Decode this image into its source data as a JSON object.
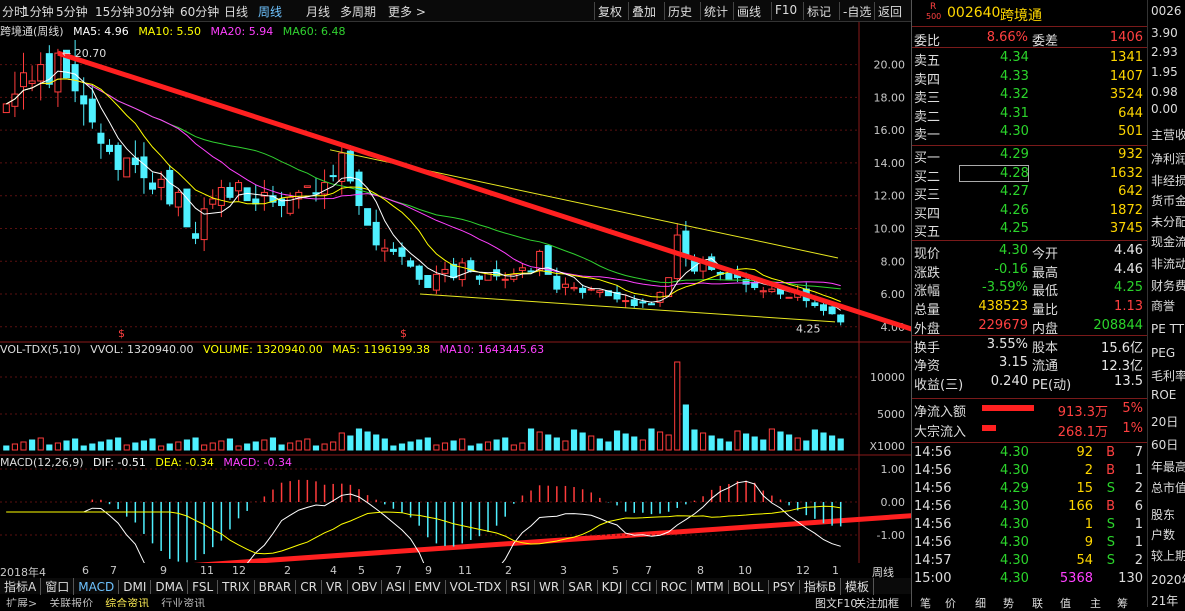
{
  "top_tabs": [
    "分时",
    "1分钟",
    "5分钟",
    "15分钟",
    "30分钟",
    "60分钟",
    "日线",
    "周线",
    "月线",
    "多周期",
    "更多 >"
  ],
  "top_tools": [
    "复权",
    "叠加",
    "历史",
    "统计",
    "画线",
    "F10",
    "标记",
    "-自选",
    "返回"
  ],
  "chart_title": "跨境通(周线)",
  "main_legend": {
    "ma5": "MA5: 4.96",
    "ma10": "MA10: 5.50",
    "ma20": "MA20: 5.94",
    "ma60": "MA60: 6.48"
  },
  "vol_legend": {
    "name": "VOL-TDX(5,10)",
    "vvol": "VVOL: 1320940.00",
    "volume": "VOLUME: 1320940.00",
    "ma5": "MA5: 1196199.38",
    "ma10": "MA10: 1643445.63"
  },
  "macd_legend": {
    "name": "MACD(12,26,9)",
    "dif": "DIF: -0.51",
    "dea": "DEA: -0.34",
    "macd": "MACD: -0.34"
  },
  "price_axis": [
    "20.00",
    "18.00",
    "16.00",
    "14.00",
    "12.00",
    "10.00",
    "8.00",
    "6.00",
    "4.00"
  ],
  "vol_axis": [
    "10000",
    "5000",
    "X1000"
  ],
  "macd_axis": [
    "1.00",
    "0.00",
    "-1.00"
  ],
  "high_label": "20.70",
  "low_label": "4.25",
  "dollar_mark": "$",
  "x_axis": [
    "2018年4",
    "6",
    "7",
    "9",
    "11",
    "12",
    "2",
    "4",
    "5",
    "7",
    "9",
    "11",
    "2",
    "3",
    "5",
    "7",
    "8",
    "10",
    "12",
    "1"
  ],
  "period_label": "周线",
  "indicator_tabs": [
    "指标A",
    "窗口",
    "MACD",
    "DMI",
    "DMA",
    "FSL",
    "TRIX",
    "BRAR",
    "CR",
    "VR",
    "OBV",
    "ASI",
    "EMV",
    "VOL-TDX",
    "RSI",
    "WR",
    "SAR",
    "KDJ",
    "CCI",
    "ROC",
    "MTM",
    "BOLL",
    "PSY",
    "指标B",
    "模板"
  ],
  "bottom_tabs": [
    "扩展>",
    "关联报价",
    "综合资讯",
    "行业资讯"
  ],
  "bottom_right": [
    "图文F10",
    "关注加框",
    "笔",
    "价",
    "细",
    "势",
    "联",
    "值",
    "主",
    "筹"
  ],
  "chart_data": {
    "type": "candlestick",
    "title": "跨境通(周线)",
    "period": "weekly",
    "ylim": [
      3.5,
      21.5
    ],
    "weekly_close": [
      17.6,
      18.2,
      19.5,
      19.0,
      20.0,
      18.8,
      20.7,
      19.2,
      18.4,
      17.6,
      16.5,
      15.2,
      14.7,
      13.6,
      14.3,
      13.9,
      13.1,
      12.4,
      13.0,
      11.5,
      12.2,
      10.1,
      9.4,
      11.2,
      11.8,
      12.5,
      11.9,
      12.8,
      11.7,
      11.5,
      12.2,
      11.6,
      11.4,
      11.9,
      12.2,
      12.6,
      12.1,
      12.8,
      13.2,
      14.6,
      12.9,
      11.4,
      10.2,
      9.0,
      8.8,
      8.6,
      8.3,
      7.7,
      6.9,
      6.4,
      7.2,
      7.5,
      7.0,
      7.9,
      7.4,
      6.9,
      7.3,
      7.1,
      6.9,
      7.2,
      7.6,
      7.4,
      8.6,
      7.2,
      6.3,
      6.6,
      6.4,
      6.1,
      6.3,
      6.2,
      5.9,
      5.7,
      5.6,
      5.3,
      5.5,
      5.4,
      6.1,
      7.0,
      9.6,
      8.3,
      7.4,
      8.0,
      7.5,
      7.2,
      6.9,
      7.0,
      6.6,
      6.4,
      6.2,
      6.3,
      6.0,
      5.8,
      6.1,
      5.6,
      5.3,
      5.0,
      4.8,
      4.3
    ],
    "ma5": 4.96,
    "ma10": 5.5,
    "ma20": 5.94,
    "ma60": 6.48,
    "volume_scale": "X1000",
    "vol_ma5": 1196199.38,
    "vol_ma10": 1643445.63,
    "volume": 1320940.0,
    "macd": {
      "dif": -0.51,
      "dea": -0.34,
      "macd": -0.34
    }
  },
  "rp_header": {
    "badge": "R",
    "code": "002640",
    "name": "跨境通",
    "badge2": "500"
  },
  "weibi": {
    "l1": "委比",
    "v1": "8.66%",
    "l2": "委差",
    "v2": "1406"
  },
  "sell": [
    {
      "label": "卖五",
      "price": "4.34",
      "vol": "1341"
    },
    {
      "label": "卖四",
      "price": "4.33",
      "vol": "1407"
    },
    {
      "label": "卖三",
      "price": "4.32",
      "vol": "3524"
    },
    {
      "label": "卖二",
      "price": "4.31",
      "vol": "644"
    },
    {
      "label": "卖一",
      "price": "4.30",
      "vol": "501"
    }
  ],
  "buy": [
    {
      "label": "买一",
      "price": "4.29",
      "vol": "932"
    },
    {
      "label": "买二",
      "price": "4.28",
      "vol": "1632"
    },
    {
      "label": "买三",
      "price": "4.27",
      "vol": "642"
    },
    {
      "label": "买四",
      "price": "4.26",
      "vol": "1872"
    },
    {
      "label": "买五",
      "price": "4.25",
      "vol": "3745"
    }
  ],
  "stats": [
    {
      "l1": "现价",
      "v1": "4.30",
      "c1": "green",
      "l2": "今开",
      "v2": "4.46",
      "c2": "white"
    },
    {
      "l1": "涨跌",
      "v1": "-0.16",
      "c1": "green",
      "l2": "最高",
      "v2": "4.46",
      "c2": "white"
    },
    {
      "l1": "涨幅",
      "v1": "-3.59%",
      "c1": "green",
      "l2": "最低",
      "v2": "4.25",
      "c2": "green"
    },
    {
      "l1": "总量",
      "v1": "438523",
      "c1": "yellow",
      "l2": "量比",
      "v2": "1.13",
      "c2": "red"
    },
    {
      "l1": "外盘",
      "v1": "229679",
      "c1": "red",
      "l2": "内盘",
      "v2": "208844",
      "c2": "green"
    },
    {
      "l1": "换手",
      "v1": "3.55%",
      "c1": "white",
      "l2": "股本",
      "v2": "15.6亿",
      "c2": "white"
    },
    {
      "l1": "净资",
      "v1": "3.15",
      "c1": "white",
      "l2": "流通",
      "v2": "12.3亿",
      "c2": "white"
    },
    {
      "l1": "收益(三)",
      "v1": "0.240",
      "c1": "white",
      "l2": "PE(动)",
      "v2": "13.5",
      "c2": "white"
    }
  ],
  "flows": [
    {
      "label": "净流入额",
      "value": "913.3万",
      "pct": "5%"
    },
    {
      "label": "大宗流入",
      "value": "268.1万",
      "pct": "1%"
    }
  ],
  "ticks": [
    {
      "t": "14:56",
      "p": "4.30",
      "v": "92",
      "s": "B",
      "n": "7"
    },
    {
      "t": "14:56",
      "p": "4.30",
      "v": "2",
      "s": "B",
      "n": "1"
    },
    {
      "t": "14:56",
      "p": "4.29",
      "v": "15",
      "s": "S",
      "n": "2"
    },
    {
      "t": "14:56",
      "p": "4.30",
      "v": "166",
      "s": "B",
      "n": "6"
    },
    {
      "t": "14:56",
      "p": "4.30",
      "v": "1",
      "s": "S",
      "n": "1"
    },
    {
      "t": "14:56",
      "p": "4.30",
      "v": "9",
      "s": "S",
      "n": "1"
    },
    {
      "t": "14:57",
      "p": "4.30",
      "v": "54",
      "s": "S",
      "n": "2"
    },
    {
      "t": "15:00",
      "p": "4.30",
      "v": "5368",
      "s": "",
      "n": "130"
    }
  ],
  "far_panel": [
    "0026",
    "3.90",
    "2.93",
    "1.95",
    "0.98",
    "0.00",
    "主营收",
    "净利润",
    "非经损",
    "货币金",
    "未分配",
    "现金流",
    "非流动",
    "财务费",
    "商誉",
    "PE TTM",
    "PEG",
    "毛利率",
    "ROE",
    "20日",
    "60日",
    "年最高",
    "总市值",
    "股东",
    "户数",
    "较上期",
    "2020年",
    "21年"
  ],
  "colors": {
    "up": "#ff3c3c",
    "down": "#4ff0ff",
    "ma5": "#ffffff",
    "ma10": "#ffff00",
    "ma20": "#ff40ff",
    "ma60": "#30d030",
    "trend_red": "#ff2020",
    "channel": "#e8e820"
  }
}
